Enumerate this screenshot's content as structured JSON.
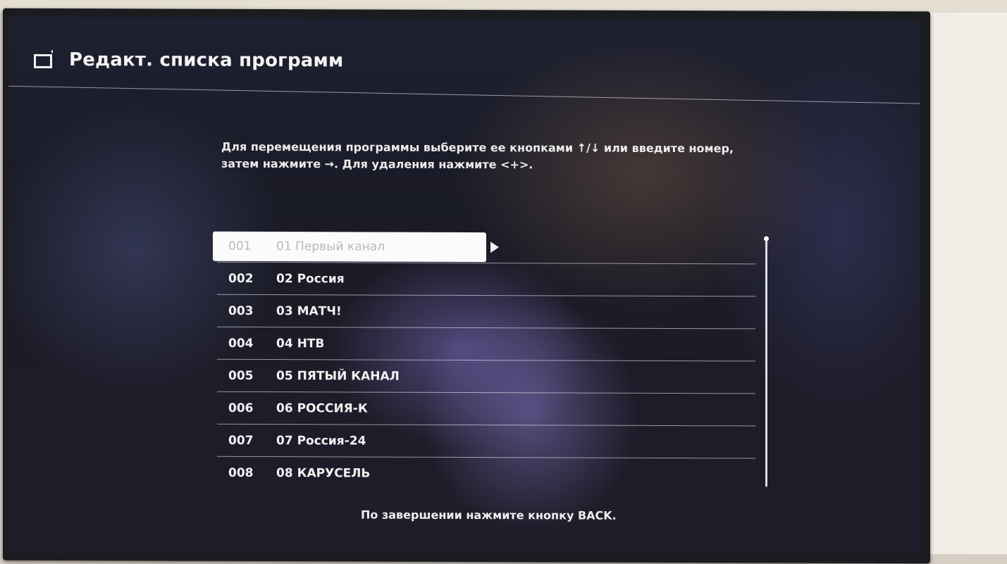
{
  "header": {
    "title": "Редакт. списка программ",
    "icon": "tv-icon"
  },
  "instructions": {
    "line1": "Для перемещения программы выберите ее кнопками ↑/↓ или введите номер,",
    "line2": "затем нажмите →. Для удаления нажмите <+>."
  },
  "channels": [
    {
      "number": "001",
      "name": "01 Первый канал",
      "selected": true
    },
    {
      "number": "002",
      "name": "02 Россия"
    },
    {
      "number": "003",
      "name": "03 МАТЧ!"
    },
    {
      "number": "004",
      "name": "04 НТВ"
    },
    {
      "number": "005",
      "name": "05 ПЯТЫЙ КАНАЛ"
    },
    {
      "number": "006",
      "name": "06 РОССИЯ-К"
    },
    {
      "number": "007",
      "name": "07 Россия-24"
    },
    {
      "number": "008",
      "name": "08 КАРУСЕЛЬ"
    }
  ],
  "footer": {
    "hint": "По завершении нажмите кнопку BACK."
  },
  "colors": {
    "highlight": "#fbfbfb",
    "text": "#f1f1f1",
    "selected_text": "#b9b9b9"
  }
}
